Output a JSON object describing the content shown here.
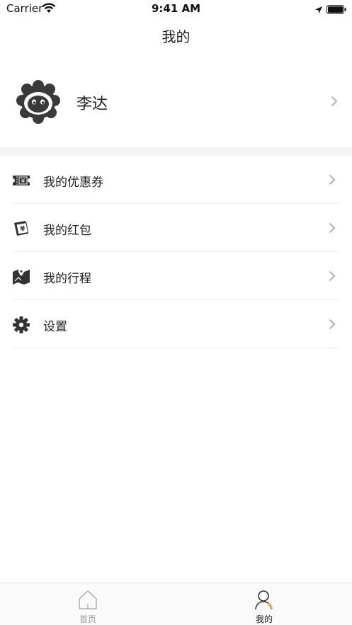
{
  "status_bar": {
    "carrier": "Carrier",
    "time": "9:41 AM"
  },
  "nav": {
    "title": "我的"
  },
  "profile": {
    "name": "李达"
  },
  "menu": {
    "items": [
      {
        "label": "我的优惠券",
        "icon": "coupon-icon"
      },
      {
        "label": "我的红包",
        "icon": "red-packet-icon"
      },
      {
        "label": "我的行程",
        "icon": "trip-map-icon"
      },
      {
        "label": "设置",
        "icon": "gear-icon"
      }
    ]
  },
  "tab_bar": {
    "tabs": [
      {
        "label": "首页",
        "icon": "home-icon",
        "active": false
      },
      {
        "label": "我的",
        "icon": "user-icon",
        "active": true
      }
    ]
  },
  "colors": {
    "accent": "#f5c518",
    "text": "#222222",
    "inactive_tab": "#999999",
    "section_gap": "#f4f4f4"
  }
}
